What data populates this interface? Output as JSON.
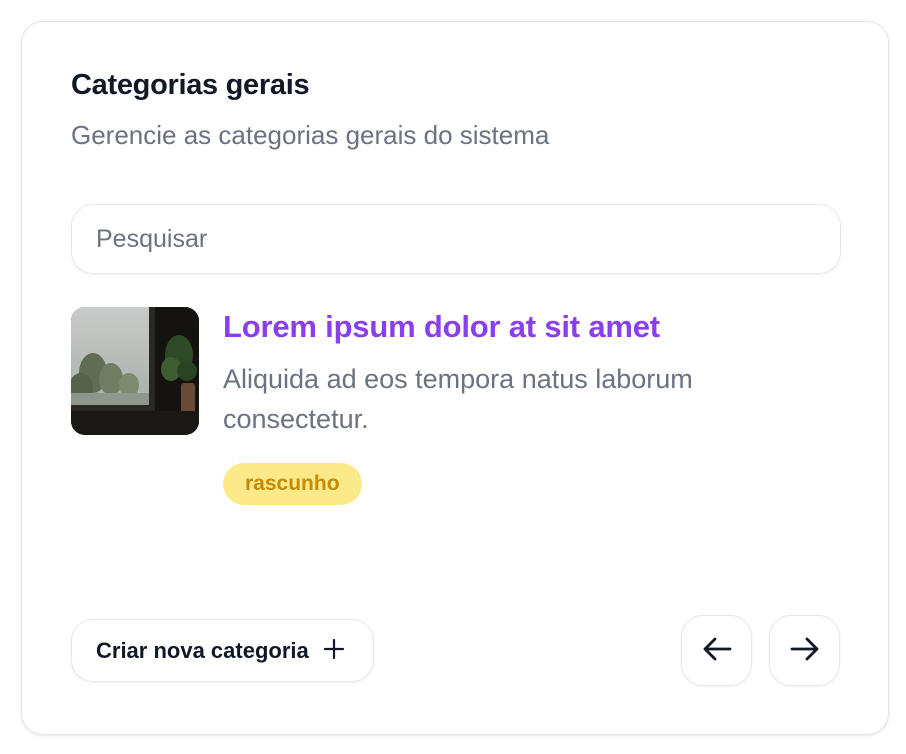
{
  "header": {
    "title": "Categorias gerais",
    "subtitle": "Gerencie as categorias gerais do sistema"
  },
  "search": {
    "placeholder": "Pesquisar",
    "value": ""
  },
  "items": [
    {
      "title": "Lorem ipsum dolor at sit amet",
      "description": "Aliquida ad eos tempora natus laborum consectetur.",
      "status": "rascunho"
    }
  ],
  "footer": {
    "create_label": "Criar nova categoria",
    "create_icon": "plus-icon",
    "prev_icon": "arrow-left-icon",
    "next_icon": "arrow-right-icon"
  },
  "colors": {
    "accent": "#8b3df0",
    "badge_bg": "#fbe98a",
    "badge_text": "#c58a06",
    "muted_text": "#6b7280"
  }
}
